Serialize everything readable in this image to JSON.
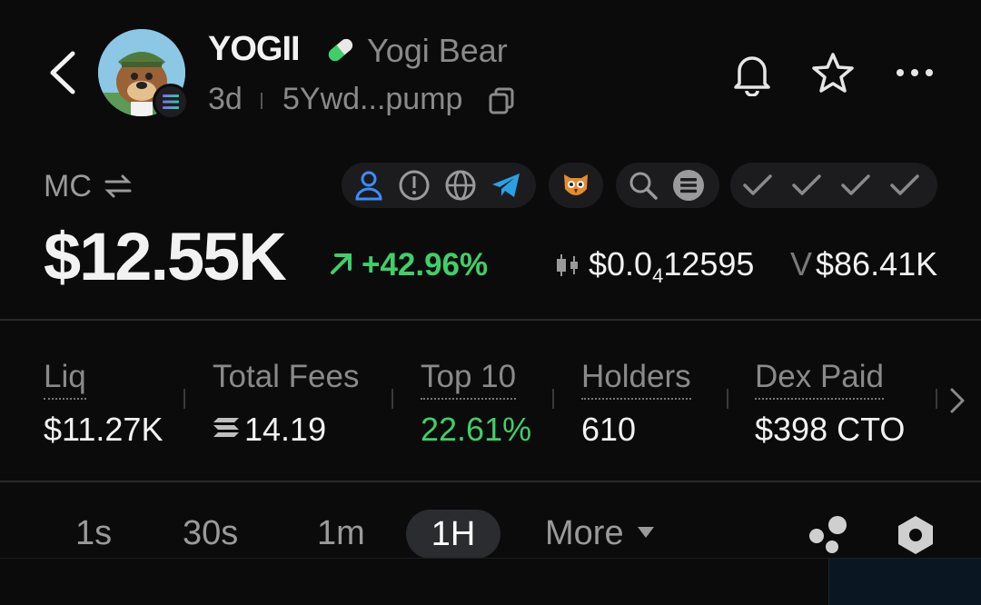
{
  "header": {
    "ticker": "YOGII",
    "name": "Yogi Bear",
    "age": "3d",
    "address": "5Ywd...pump"
  },
  "market": {
    "mc_label": "MC",
    "mc_value": "$12.55K",
    "change": "+42.96%",
    "price_prefix": "$0.0",
    "price_zeros": "4",
    "price_digits": "12595",
    "volume_label": "V",
    "volume": "$86.41K"
  },
  "stats": [
    {
      "label": "Liq",
      "value": "$11.27K"
    },
    {
      "label": "Total Fees",
      "value": "14.19"
    },
    {
      "label": "Top 10",
      "value": "22.61%"
    },
    {
      "label": "Holders",
      "value": "610"
    },
    {
      "label": "Dex Paid",
      "value": "$398 CTO"
    }
  ],
  "timeframes": {
    "items": [
      "1s",
      "30s",
      "1m",
      "1H"
    ],
    "active": "1H",
    "more_label": "More"
  },
  "colors": {
    "positive": "#3fcf6a",
    "link_blue": "#3a8dff",
    "background": "#0b0b0b"
  },
  "icons": [
    "back-arrow-icon",
    "solana-icon",
    "pill-icon",
    "copy-icon",
    "bell-icon",
    "star-icon",
    "more-dots-icon",
    "swap-icon",
    "dev-icon",
    "warning-icon",
    "website-icon",
    "telegram-icon",
    "owl-icon",
    "search-icon",
    "solana-coin-icon",
    "check-icon",
    "arrow-up-right-icon",
    "candle-icon",
    "chevron-right-icon",
    "bubble-map-icon",
    "settings-hex-icon"
  ]
}
